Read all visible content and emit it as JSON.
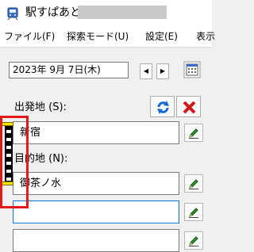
{
  "window": {
    "title": "駅すぱあと",
    "icon": "train-app-icon"
  },
  "menu": [
    {
      "label": "ファイル(F)"
    },
    {
      "label": "探索モード(U)"
    },
    {
      "label": "設定(E)"
    },
    {
      "label": "表示"
    }
  ],
  "date": {
    "value": "2023年 9月 7日(木)",
    "prev_label": "◀",
    "next_label": "▶"
  },
  "departure": {
    "label": "出発地 (S):",
    "value": "新宿"
  },
  "destination": {
    "label": "目的地 (N):",
    "value": "御茶ノ水"
  },
  "via": [
    {
      "value": ""
    },
    {
      "value": ""
    }
  ],
  "colors": {
    "highlight": "#e31a1a",
    "swap_icon": "#1a6ad6",
    "clear_icon": "#d01818",
    "drag_cap": "#f5e600",
    "focus": "#0078d7"
  }
}
